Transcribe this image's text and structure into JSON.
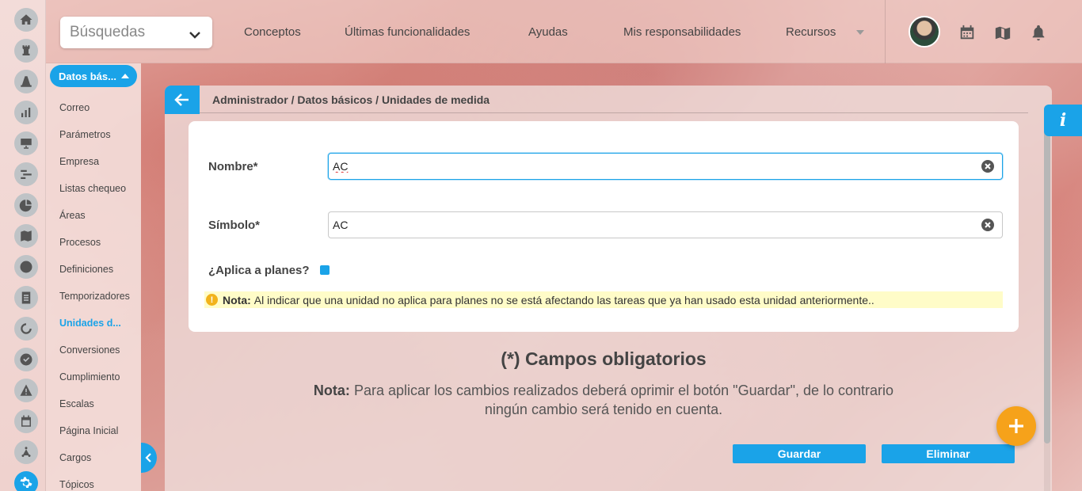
{
  "topbar": {
    "search_placeholder": "Búsquedas",
    "nav": [
      "Conceptos",
      "Últimas funcionalidades",
      "Ayudas",
      "Mis responsabilidades",
      "Recursos"
    ]
  },
  "rail": {
    "icons": [
      "home-icon",
      "chess-rook-icon",
      "cone-icon",
      "bar-chart-icon",
      "presentation-icon",
      "gantt-icon",
      "pie-chart-icon",
      "map-icon",
      "clock-icon",
      "document-icon",
      "cycle-icon",
      "check-circle-icon",
      "warning-icon",
      "calendar-icon",
      "network-icon",
      "gear-icon"
    ]
  },
  "sidebar": {
    "section_label": "Datos bás...",
    "items": [
      "Correo",
      "Parámetros",
      "Empresa",
      "Listas chequeo",
      "Áreas",
      "Procesos",
      "Definiciones",
      "Temporizadores",
      "Unidades d...",
      "Conversiones",
      "Cumplimiento",
      "Escalas",
      "Página Inicial",
      "Cargos",
      "Tópicos"
    ],
    "active_index": 8
  },
  "main": {
    "breadcrumb": "Administrador / Datos básicos / Unidades de medida",
    "form": {
      "nombre_label": "Nombre*",
      "nombre_value": "AC",
      "simbolo_label": "Símbolo*",
      "simbolo_value": "AC",
      "aplica_label": "¿Aplica a planes?",
      "aplica_checked": true,
      "note_label": "Nota:",
      "note_text": "Al indicar que una unidad no aplica para planes no se está afectando las tareas que ya han usado esta unidad anteriormente.."
    },
    "required_title": "(*) Campos obligatorios",
    "save_note_label": "Nota:",
    "save_note_text": "Para aplicar los cambios realizados deberá oprimir el botón \"Guardar\", de lo contrario ningún cambio será tenido en cuenta.",
    "buttons": {
      "save": "Guardar",
      "delete": "Eliminar"
    }
  },
  "info_tab": "i",
  "colors": {
    "accent": "#1aa3e8",
    "fab": "#f6a21a",
    "note_bg": "#fffcc8"
  }
}
